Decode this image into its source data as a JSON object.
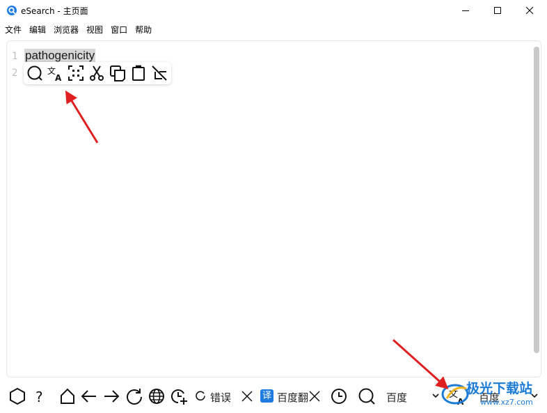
{
  "window": {
    "title": "eSearch - 主页面",
    "accent": "#1e7be0"
  },
  "menu": [
    "文件",
    "编辑",
    "浏览器",
    "视图",
    "窗口",
    "帮助"
  ],
  "editor": {
    "line_numbers": [
      "1",
      "2"
    ],
    "text": "pathogenicity"
  },
  "popup_toolbar": {
    "icons": [
      "search-icon",
      "translate-icon",
      "ocr-scan-icon",
      "cut-icon",
      "copy-icon",
      "paste-icon",
      "clear-format-icon"
    ]
  },
  "bottom_bar": {
    "reload_status": "错误",
    "translate_badge": "译",
    "translate_engine_tab": "百度翻",
    "search_engine": "百度",
    "translate_engine": "百度"
  },
  "watermark": {
    "text": "极光下载站",
    "url": "www.xz7.com"
  },
  "colors": {
    "arrow": "#e02020",
    "badge": "#1e7be0"
  }
}
